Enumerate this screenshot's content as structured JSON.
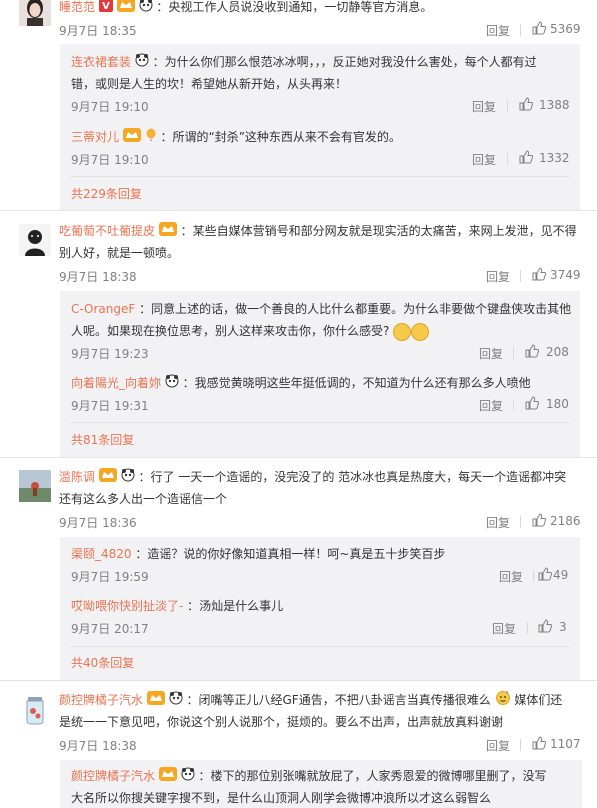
{
  "comments": [
    {
      "user": "睡范范",
      "text": "：央视工作人员说没收到通知，一切静等官方消息。",
      "time": "9月7日 18:35",
      "reply_label": "回复",
      "likes": "5369"
    },
    {
      "user": "吃葡萄不吐葡提皮",
      "text_line1": "：某些自媒体营销号和部分网友就是现实活的太痛苦，来网上发泄，见不得",
      "text_line2": "别人好，就是一顿喷。",
      "time": "9月7日 18:38",
      "reply_label": "回复",
      "likes": "3749"
    },
    {
      "user": "滥陈调",
      "text_line1": "：行了 一天一个造谣的，没完没了的 范冰冰也真是热度大，每天一个造谣都冲突",
      "text_line2": "还有这么多人出一个造谣信一个",
      "time": "9月7日 18:36",
      "reply_label": "回复",
      "likes": "2186"
    },
    {
      "user": "颜控牌橘子汽水",
      "text_line1": "：闭嘴等正儿八经GF通告，不把八卦谣言当真传播很难么",
      "text_line1b": "媒体们还",
      "text_line2": "是统一一下意见吧，你说这个别人说那个，挺烦的。要么不出声，出声就放真料谢谢",
      "time": "9月7日 18:38",
      "reply_label": "回复",
      "likes": "1107"
    }
  ],
  "replies": [
    {
      "user": "连衣裙套装",
      "text_line1": "：为什么你们那么恨范冰冰啊，，，反正她对我没什么害处，每个人都有过",
      "text_line2": "错，或则是人生的坎！希望她从新开始，从头再来！",
      "time": "9月7日 19:10",
      "reply_label": "回复",
      "likes": "1388"
    },
    {
      "user": "三蒂对儿",
      "text": "：所谓的“封杀”这种东西从来不会有官发的。",
      "time": "9月7日 19:10",
      "reply_label": "回复",
      "likes": "1332"
    },
    {
      "user": "C-OrangeF",
      "text_line1": "：同意上述的话，做一个善良的人比什么都重要。为什么非要做个键盘侠攻击其他",
      "text_line2": "人呢。如果现在换位思考，别人这样来攻击你，你什么感受?",
      "time": "9月7日 19:23",
      "reply_label": "回复",
      "likes": "208"
    },
    {
      "user": "向着陽光_向着妳",
      "text": "：我感觉黄晓明这些年挺低调的，不知道为什么还有那么多人喷他",
      "time": "9月7日 19:31",
      "reply_label": "回复",
      "likes": "180"
    },
    {
      "user": "渠颐_4820",
      "text": "：造谣？说的你好像知道真相一样！呵~真是五十步笑百步",
      "time": "9月7日 19:59",
      "reply_label": "回复",
      "likes": "49"
    },
    {
      "user": "哎呦喂你快别扯淡了-",
      "text": "：汤灿是什么事儿",
      "time": "9月7日 20:17",
      "reply_label": "回复",
      "likes": "3"
    },
    {
      "user": "颜控牌橘子汽水",
      "text_line1": "：楼下的那位别张嘴就放屁了，人家秀恩爱的微博哪里删了，没写",
      "text_line2": "大名所以你搜关键字搜不到，是什么山顶洞人刚学会微博冲浪所以才这么弱智么"
    }
  ],
  "totals": [
    "共229条回复",
    "共81条回复",
    "共40条回复"
  ],
  "colors": {
    "link": "#eb7350",
    "reply_bg": "#f2f2f5",
    "meta": "#808080",
    "text": "#333333"
  }
}
